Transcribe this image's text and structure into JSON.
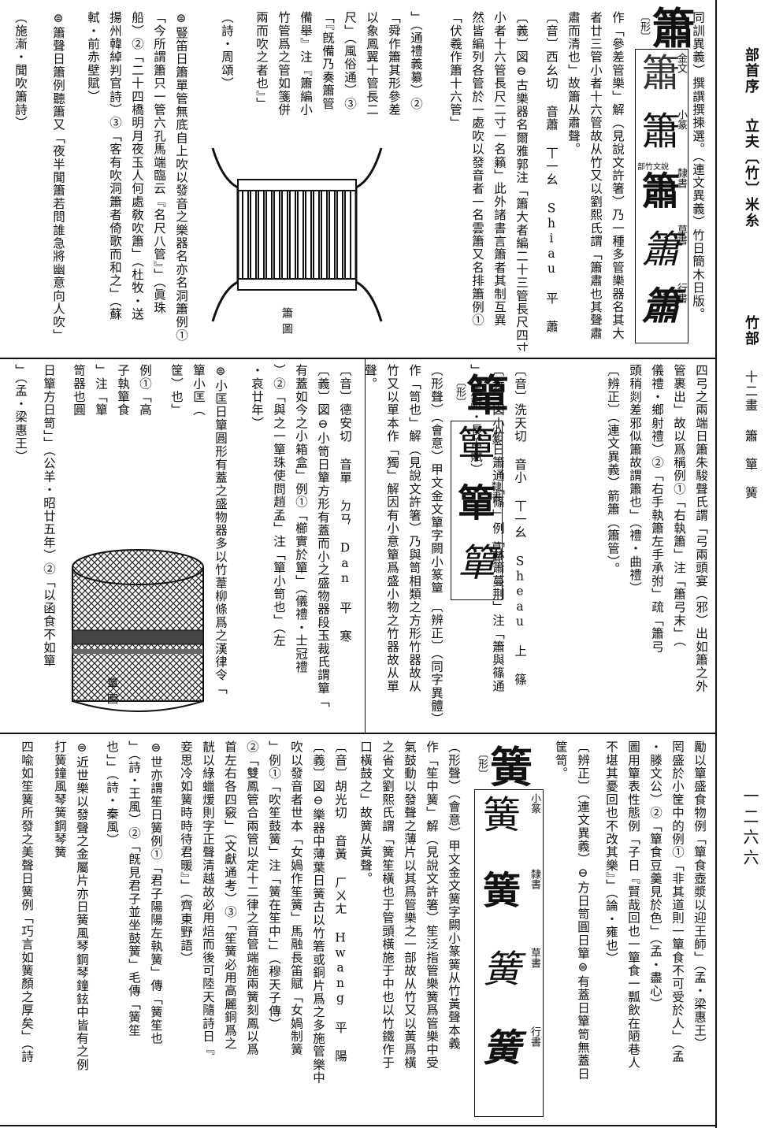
{
  "header": {
    "section_label": "部首序",
    "radical_line": "立夫〔竹〕米糸",
    "radical_name": "竹部",
    "stroke_label": "十二畫",
    "chars_line": "簫　簞　簧",
    "page_number": "一二六六"
  },
  "entry_xiao": {
    "headword": "簫",
    "form_tag": "〔形〕",
    "head_note": "同訓異義）撰譔撰揀選。（連文異義）竹日簡木日版。",
    "cols": [
      "作「參差管樂」解（見說文許箸）乃一種多管樂器名其大",
      "者廿三管小者十六管故从竹又以劉熙氏謂「簫肅也其聲肅",
      "肅而清也」故簫从肅聲。",
      "〔音〕西幺切 音蕭 丅一幺 Shiau 平 蕭",
      "〔義〕図⊖古樂器名爾雅郭注「簫大者編二十三管長尺四寸",
      "小者十六管長尺二寸一名籟」此外諸書言簫者其制互異",
      "然皆編列各管於一處吹以發音者一名雲簫又名排簫例①",
      "「伏羲作簫十六管」",
      "」（通禮義纂）②",
      "「舜作簫其形參差",
      "以象鳳翼十管長二",
      "尺」（風俗通）③",
      "「『旣備乃奏簫管",
      "備舉』注『簫編小",
      "竹管爲之管如箋併",
      "兩而吹之者也』」",
      "（詩・周頌）",
      "⊜豎笛日簫單管無底自上吹以發音之樂器名亦名洞簫例①",
      "「今所謂簫只一管六孔馬端臨云『名尺八管』」（眞珠",
      "船）②「二十四橋明月夜玉人何處敎吹簫」（杜牧・送",
      "揚州韓綽判官詩）③「客有吹洞簫者倚歌而和之」（蘇",
      "軾・前赤壁賦）",
      "⊜簫聲日簫例聽簫又「夜半聞簫若問誰急將幽意向人吹」",
      "（施漸・聞吹簫詩）"
    ],
    "cont_cols": [
      "四弓之兩端日簫朱駿聲氏謂「弓兩頭宴（邪）出如簫之外",
      "管裹出」故以爲稱例①「右執簫」注「簫弓末」（",
      "儀禮・鄉射禮）②「右手執簫左手承弣」疏「簫弓",
      "頭稍剡差邪似簫故謂簫也」（禮・曲禮）",
      "〔辨正〕（連文異義）箭簫（簫管）。"
    ],
    "figure_caption": "簫圖",
    "script_forms": [
      {
        "label": "金文",
        "extra": "齊"
      },
      {
        "label": "小篆",
        "extra": "部竹文說"
      },
      {
        "label": "隸書",
        "extra": "古"
      },
      {
        "label": "草書",
        "extra": "之獻王"
      },
      {
        "label": "行書",
        "extra": "米"
      }
    ]
  },
  "entry_dan": {
    "headword": "簞",
    "form_tag": "〔形〕",
    "cols": [
      "〔音〕洗天切 音小 丅一幺 Sheau 上 篠",
      "〔義〕図小竹日簫通「篠」例「林簫蔓荆」注「簫與篠通",
      "」（馬融・長笛賦）",
      "〔辨正〕（同字異體）簫（簫觔字）",
      "（形聲）（會意）甲文金文簞字闕小篆簞从竹單聲本義",
      "作「笥也」解（見說文許箸）乃與笥相類之方形竹器故从",
      "竹又以單本作「獨」解因有小意簞爲盛小物之竹器故从單",
      "聲。",
      "〔音〕德安切 音單 ㄉㄢ Dan 平 寒",
      "〔義〕図⊖小笥日簞方形有蓋而小之盛物器段玉裁氏謂簞「",
      "有蓋如今之小箱盒」例①「櫛實於簞」（儀禮・士冠禮",
      "）②「與之一簞珠使問趙孟」注「簞小笥也」（左",
      "・哀廿年）",
      "⊜小匡日簞圓形有蓋之盛物器多以竹葦柳條爲之漢律令「",
      "簞小匡（",
      "筐）也」",
      "例①「高",
      "子執簞食",
      "」注「簞",
      "笥器也圓",
      "日簞方日笥」」（公羊・昭廿五年）②「以函食不如簞",
      "」（孟・梁惠王）"
    ],
    "figure_caption": "簞圖",
    "script_forms": [
      {
        "label": "小篆",
        "extra": "部竹文說"
      },
      {
        "label": "隸書",
        "extra": "人道"
      },
      {
        "label": "草書",
        "extra": "帖"
      }
    ]
  },
  "entry_huang": {
    "headword": "簧",
    "form_tag": "〔形〕",
    "cols": [
      "勵以簞盛食物例「簞食壺漿以迎王師」（孟・梁惠王）",
      "罔盛於小筐中的例①「非其道則一簞食不可受於人」（孟",
      "・滕文公）②「簞食豆羹見於色」（孟・盡心）",
      "圖用簞表性態例「子日『賢哉回也一簞食一瓢飲在陋巷人",
      "不堪其憂回也不改其樂』」（論・雍也）",
      "〔辨正〕（連文異義）⊖方日笥圓日簞⊜有蓋日簞笥無蓋日",
      "筐笥。",
      "（形聲）（會意）甲文金文簧字闕小篆簧从竹黃聲本義",
      "作「笙中簧」解（見說文許箸）笙泛指管樂簧爲管樂中受",
      "氣鼓動以發聲之薄片以其爲管樂之一部故从竹又以黃爲橫",
      "之省文劉熙氏謂「簧笙橫也于管頭橫施于中也以竹鐵作于",
      "口橫鼓之」故簧从黃聲。",
      "〔音〕胡光切 音黃 ㄏㄨㄤ Hwang 平 陽",
      "〔義〕図⊖樂器中薄葉日簧古以竹箬或銅片爲之多施管樂中",
      "吹以發音者世本「女媧作笙簧」馬融長笛賦「女媧制簧",
      "」例①「吹笙鼓簧」注「簧在笙中」」（穆天子傳）",
      "②「雙鳳管合兩管以定十二律之音管端施兩簧刻鳳以爲",
      "首左右各四竅」（文獻通考）③「笙簧必用高麗銅爲之",
      "靗以綠蠟煖則字正聲清越故必用焙而後可陸天隨詩日『",
      "妾思冷如簧時時待君暖』」（齊東野語）",
      "⊜世亦謂笙日簧例①「君子陽陽左執簧」傳「簧笙也",
      "」（詩・王風）②「旣見君子並坐鼓簧」毛傳「簧笙",
      "也」」（詩・秦風）",
      "⊜近世樂以發聲之金屬片亦日簧風琴鋼琴鐘鉉中皆有之例",
      "打簧鐘風琴簧鋼琴簧",
      "四喩如笙簧所發之美聲日簧例「巧言如簧顏之厚矣」（詩"
    ],
    "script_forms": [
      {
        "label": "小篆",
        "extra": "部竹文說"
      },
      {
        "label": "隸書",
        "extra": "人道"
      },
      {
        "label": "草書",
        "extra": "米"
      },
      {
        "label": "行書",
        "extra": "斯覺"
      }
    ]
  }
}
